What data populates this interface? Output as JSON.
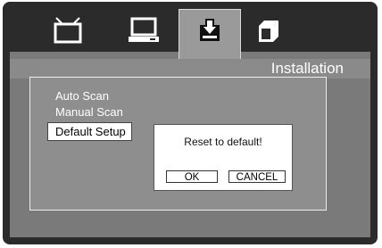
{
  "tabs": [
    {
      "name": "tv-icon"
    },
    {
      "name": "computer-icon"
    },
    {
      "name": "installation-icon"
    },
    {
      "name": "box-icon"
    }
  ],
  "header": {
    "title": "Installation"
  },
  "menu": {
    "items": [
      "Auto Scan",
      "Manual Scan",
      "Default Setup"
    ],
    "selected_index": 2
  },
  "dialog": {
    "message": "Reset to default!",
    "ok_label": "OK",
    "cancel_label": "CANCEL"
  },
  "colors": {
    "frame": "#2b2b2b",
    "background": "#7a7a7a",
    "active_tab": "#9a9a9a",
    "highlight": "#ffffff"
  }
}
